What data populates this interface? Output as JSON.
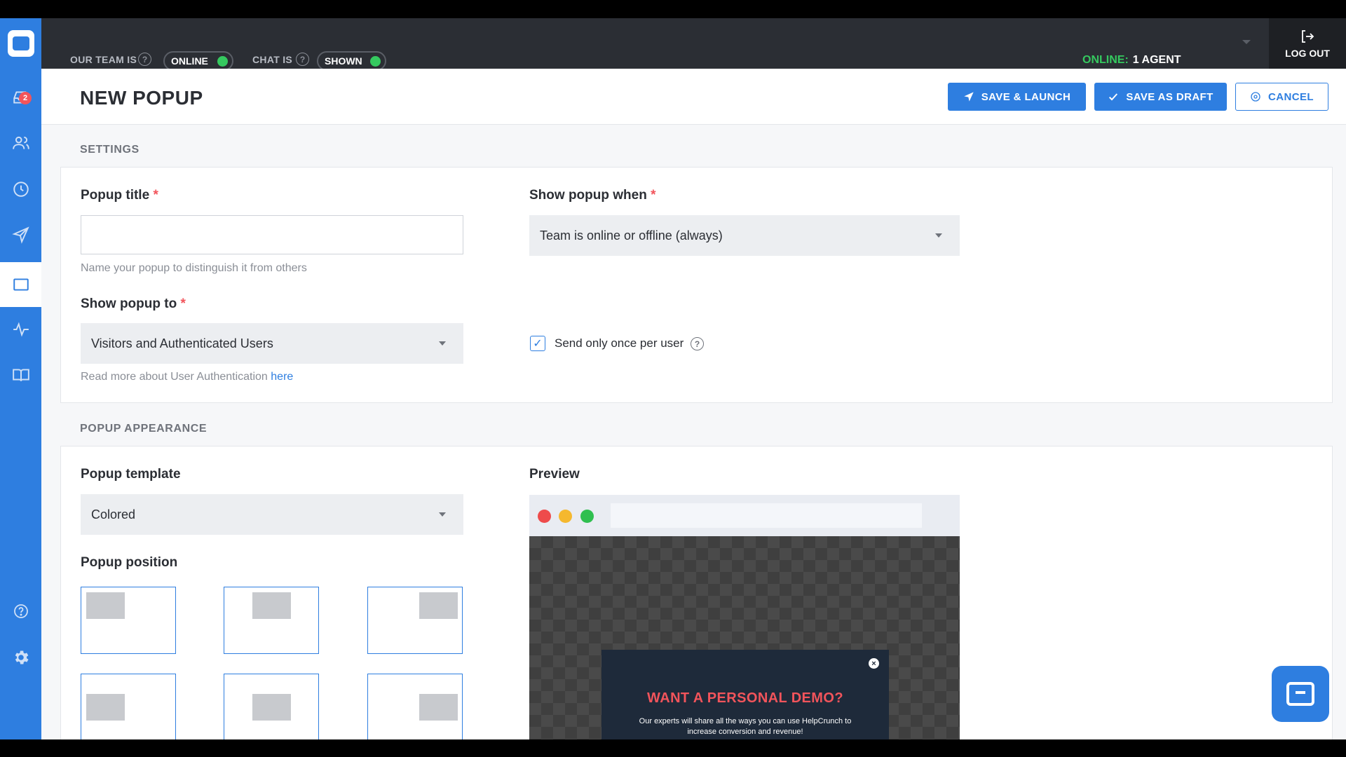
{
  "topbar": {
    "team_label": "OUR TEAM IS",
    "team_status": "ONLINE",
    "chat_label": "CHAT IS",
    "chat_status": "SHOWN",
    "online_label": "ONLINE:",
    "online_value": "1 AGENT",
    "logout_label": "LOG OUT",
    "status_color": "#35c95f"
  },
  "sidebar": {
    "badge_count": "2",
    "items": [
      {
        "icon": "inbox-icon"
      },
      {
        "icon": "users-icon"
      },
      {
        "icon": "clock-icon"
      },
      {
        "icon": "send-icon"
      },
      {
        "icon": "popup-icon",
        "active": true
      },
      {
        "icon": "activity-icon"
      },
      {
        "icon": "book-icon"
      },
      {
        "icon": "help-icon"
      },
      {
        "icon": "gear-icon"
      }
    ]
  },
  "header": {
    "title": "NEW POPUP",
    "save_launch": "SAVE & LAUNCH",
    "save_draft": "SAVE AS DRAFT",
    "cancel": "CANCEL",
    "accent_color": "#2e7ee0"
  },
  "settings": {
    "section_title": "SETTINGS",
    "popup_title_label": "Popup title",
    "popup_title_value": "",
    "popup_title_hint": "Name your popup to distinguish it from others",
    "show_to_label": "Show popup to",
    "show_to_value": "Visitors and Authenticated Users",
    "auth_hint": "Read more about User Authentication ",
    "auth_link": "here",
    "show_when_label": "Show popup when",
    "show_when_value": "Team is online or offline (always)",
    "send_once_label": "Send only once per user",
    "send_once_checked": true,
    "required_mark": "*"
  },
  "appearance": {
    "section_title": "POPUP APPEARANCE",
    "template_label": "Popup template",
    "template_value": "Colored",
    "position_label": "Popup position",
    "preview_label": "Preview",
    "preview_heading": "WANT A PERSONAL DEMO?",
    "preview_text": "Our experts will share all the ways you can use HelpCrunch to increase conversion and revenue!"
  }
}
